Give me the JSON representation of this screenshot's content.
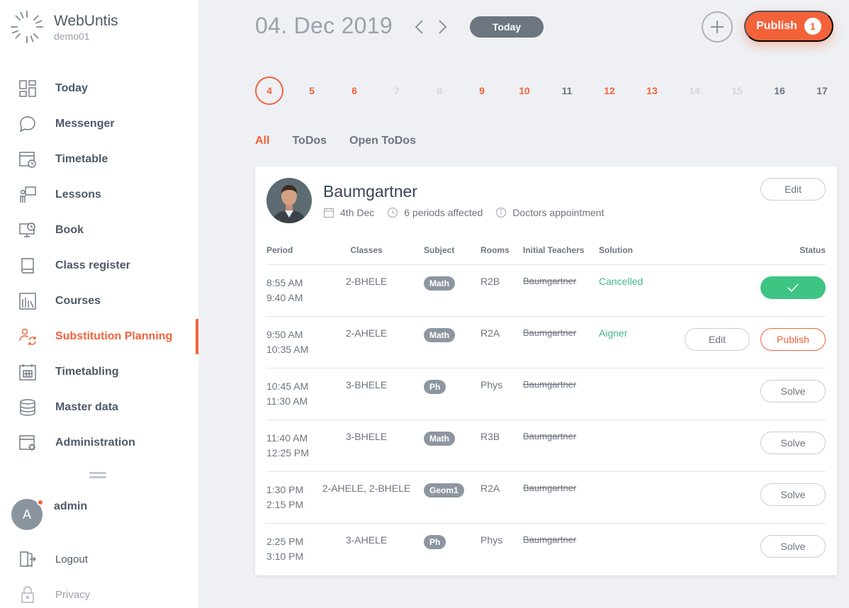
{
  "app": {
    "title": "WebUntis",
    "subtitle": "demo01"
  },
  "sidebar": {
    "items": [
      {
        "label": "Today",
        "icon": "dashboard-icon"
      },
      {
        "label": "Messenger",
        "icon": "chat-bubble-icon"
      },
      {
        "label": "Timetable",
        "icon": "timetable-clock-icon"
      },
      {
        "label": "Lessons",
        "icon": "teacher-board-icon"
      },
      {
        "label": "Book",
        "icon": "monitor-clock-icon"
      },
      {
        "label": "Class register",
        "icon": "book-icon"
      },
      {
        "label": "Courses",
        "icon": "library-icon"
      },
      {
        "label": "Substitution Planning",
        "icon": "person-swap-icon",
        "active": true
      },
      {
        "label": "Timetabling",
        "icon": "calendar-grid-icon"
      },
      {
        "label": "Master data",
        "icon": "database-icon"
      },
      {
        "label": "Administration",
        "icon": "window-gear-icon"
      }
    ],
    "user": {
      "initial": "A",
      "name": "admin"
    },
    "logout_label": "Logout",
    "privacy_label": "Privacy"
  },
  "header": {
    "date": "04. Dec 2019",
    "today_label": "Today",
    "publish_label": "Publish",
    "publish_count": "1"
  },
  "days": [
    {
      "n": "4",
      "style": "sel"
    },
    {
      "n": "5",
      "style": "red"
    },
    {
      "n": "6",
      "style": "red"
    },
    {
      "n": "7",
      "style": "muted"
    },
    {
      "n": "8",
      "style": "muted"
    },
    {
      "n": "9",
      "style": "red"
    },
    {
      "n": "10",
      "style": "red"
    },
    {
      "n": "11",
      "style": "gray"
    },
    {
      "n": "12",
      "style": "red"
    },
    {
      "n": "13",
      "style": "red"
    },
    {
      "n": "14",
      "style": "muted"
    },
    {
      "n": "15",
      "style": "muted"
    },
    {
      "n": "16",
      "style": "gray"
    },
    {
      "n": "17",
      "style": "gray"
    }
  ],
  "filters": [
    {
      "label": "All",
      "active": true
    },
    {
      "label": "ToDos"
    },
    {
      "label": "Open ToDos"
    }
  ],
  "card": {
    "name": "Baumgartner",
    "date": "4th Dec",
    "periods": "6 periods affected",
    "reason": "Doctors appointment",
    "edit_label": "Edit",
    "columns": {
      "period": "Period",
      "classes": "Classes",
      "subject": "Subject",
      "rooms": "Rooms",
      "teachers": "Initial Teachers",
      "solution": "Solution",
      "status": "Status"
    },
    "rows": [
      {
        "start": "8:55 AM",
        "end": "9:40 AM",
        "classes": "2-BHELE",
        "subject": "Math",
        "room": "R2B",
        "teacher": "Baumgartner",
        "solution": "Cancelled",
        "status": "done"
      },
      {
        "start": "9:50 AM",
        "end": "10:35 AM",
        "classes": "2-AHELE",
        "subject": "Math",
        "room": "R2A",
        "teacher": "Baumgartner",
        "solution": "Aigner",
        "status": "publish",
        "edit_label": "Edit",
        "action_label": "Publish"
      },
      {
        "start": "10:45 AM",
        "end": "11:30 AM",
        "classes": "3-BHELE",
        "subject": "Ph",
        "room": "Phys",
        "teacher": "Baumgartner",
        "solution": "",
        "status": "solve",
        "action_label": "Solve"
      },
      {
        "start": "11:40 AM",
        "end": "12:25 PM",
        "classes": "3-BHELE",
        "subject": "Math",
        "room": "R3B",
        "teacher": "Baumgartner",
        "solution": "",
        "status": "solve",
        "action_label": "Solve"
      },
      {
        "start": "1:30 PM",
        "end": "2:15 PM",
        "classes": "2-AHELE, 2-BHELE",
        "subject": "Geom1",
        "room": "R2A",
        "teacher": "Baumgartner",
        "solution": "",
        "status": "solve",
        "action_label": "Solve"
      },
      {
        "start": "2:25 PM",
        "end": "3:10 PM",
        "classes": "3-AHELE",
        "subject": "Ph",
        "room": "Phys",
        "teacher": "Baumgartner",
        "solution": "",
        "status": "solve",
        "action_label": "Solve"
      }
    ]
  },
  "colors": {
    "accent": "#f4623a",
    "success": "#3ec483",
    "text": "#4d5968",
    "muted": "#9aa3ad"
  }
}
